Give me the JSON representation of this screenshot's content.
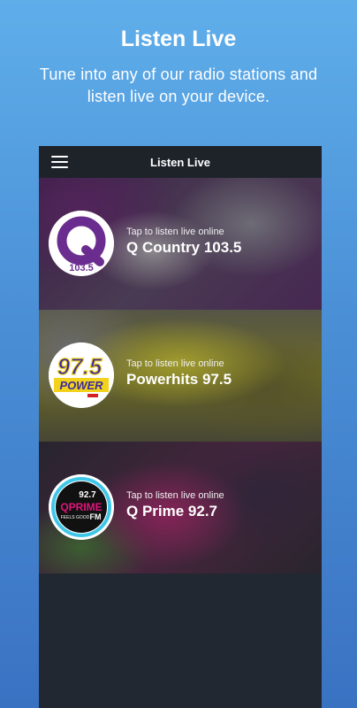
{
  "promo": {
    "title": "Listen Live",
    "subtitle": "Tune into any of our radio stations and listen live on your device."
  },
  "appbar": {
    "title": "Listen Live",
    "menu_icon": "hamburger-menu-icon"
  },
  "stations": [
    {
      "tap_label": "Tap to listen live online",
      "name": "Q Country 103.5",
      "logo_letter": "Q",
      "logo_freq": "103.5",
      "logo_color": "#6b2c8f"
    },
    {
      "tap_label": "Tap to listen live online",
      "name": "Powerhits 97.5",
      "logo_freq": "97.5",
      "logo_word": "POWER",
      "logo_color": "#3a2aa0"
    },
    {
      "tap_label": "Tap to listen live online",
      "name": "Q Prime 92.7",
      "logo_freq": "92.7",
      "logo_brand": "QPRIME",
      "logo_tagline": "FEELS GOOD",
      "logo_fm": "FM",
      "logo_color": "#e0147c"
    }
  ],
  "colors": {
    "background_top": "#5faeea",
    "background_bottom": "#3a72c2",
    "app_background": "#222831",
    "appbar_background": "#1e232a"
  }
}
